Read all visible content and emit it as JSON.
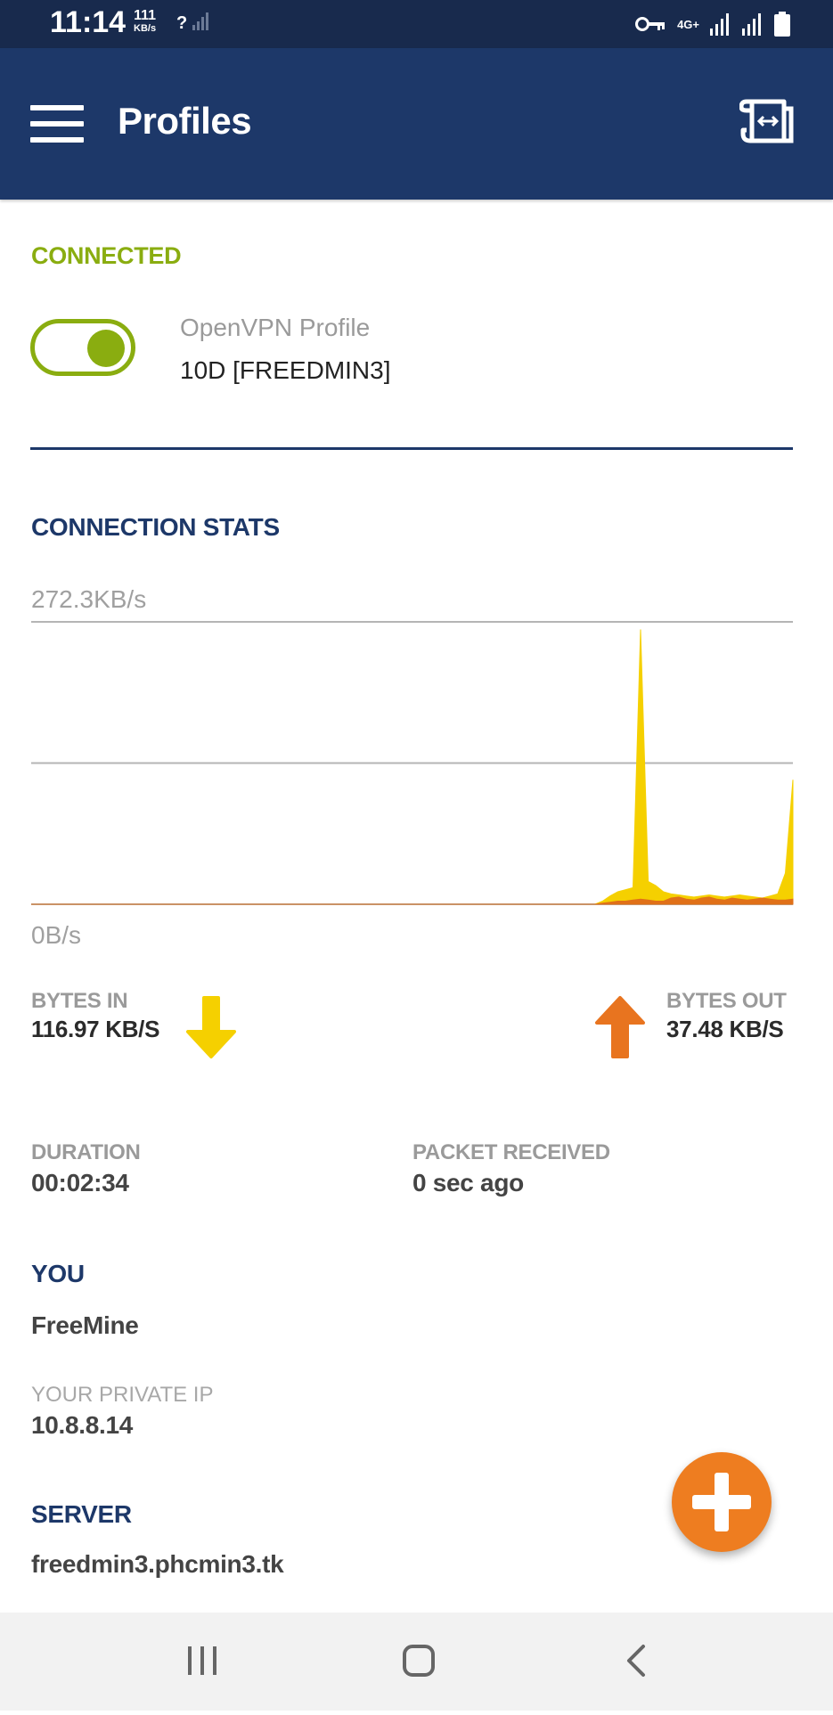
{
  "status_bar": {
    "time": "11:14",
    "speed_value": "111",
    "speed_unit": "KB/s",
    "network_unknown": "?",
    "network_type": "4G+",
    "icons": [
      "vpn-key-icon",
      "signal-icon",
      "signal-icon",
      "battery-icon"
    ]
  },
  "app_bar": {
    "title": "Profiles",
    "icons": [
      "menu-icon",
      "import-profile-icon"
    ]
  },
  "connection": {
    "status": "CONNECTED",
    "connected": true,
    "profile_type": "OpenVPN Profile",
    "profile_name": "10D [FREEDMIN3]"
  },
  "stats": {
    "heading": "CONNECTION STATS",
    "bytes_in_label": "BYTES IN",
    "bytes_in_value": "116.97 KB/S",
    "bytes_out_label": "BYTES OUT",
    "bytes_out_value": "37.48 KB/S",
    "duration_label": "DURATION",
    "duration_value": "00:02:34",
    "packet_label": "PACKET RECEIVED",
    "packet_value": "0 sec ago"
  },
  "chart_data": {
    "type": "area",
    "ylabel_max": "272.3KB/s",
    "ylabel_min": "0B/s",
    "ylim": [
      0,
      272.3
    ],
    "grid": true,
    "series": [
      {
        "color": "#f5d000",
        "values": [
          0,
          0,
          0,
          0,
          0,
          0,
          0,
          0,
          0,
          0,
          0,
          0,
          0,
          0,
          0,
          0,
          0,
          0,
          0,
          0,
          0,
          0,
          0,
          0,
          0,
          0,
          0,
          0,
          0,
          0,
          0,
          0,
          0,
          0,
          0,
          0,
          0,
          0,
          0,
          0,
          0,
          0,
          0,
          0,
          0,
          0,
          0,
          0,
          0,
          0,
          0,
          0,
          0,
          0,
          0,
          0,
          0,
          0,
          0,
          0,
          0,
          0,
          0,
          0,
          0,
          0,
          0,
          0,
          0,
          0,
          0,
          0,
          0,
          0,
          0,
          3,
          8,
          12,
          14,
          16,
          265,
          22,
          18,
          12,
          10,
          9,
          8,
          7,
          8,
          9,
          8,
          7,
          8,
          9,
          8,
          7,
          6,
          8,
          10,
          30,
          120
        ]
      },
      {
        "color": "#e07018",
        "values": [
          0,
          0,
          0,
          0,
          0,
          0,
          0,
          0,
          0,
          0,
          0,
          0,
          0,
          0,
          0,
          0,
          0,
          0,
          0,
          0,
          0,
          0,
          0,
          0,
          0,
          0,
          0,
          0,
          0,
          0,
          0,
          0,
          0,
          0,
          0,
          0,
          0,
          0,
          0,
          0,
          0,
          0,
          0,
          0,
          0,
          0,
          0,
          0,
          0,
          0,
          0,
          0,
          0,
          0,
          0,
          0,
          0,
          0,
          0,
          0,
          0,
          0,
          0,
          0,
          0,
          0,
          0,
          0,
          0,
          0,
          0,
          0,
          0,
          0,
          0,
          1,
          2,
          3,
          3,
          4,
          5,
          4,
          3,
          3,
          6,
          7,
          5,
          4,
          6,
          7,
          5,
          4,
          6,
          5,
          4,
          5,
          6,
          5,
          4,
          4,
          5
        ]
      }
    ],
    "colors": {
      "in": "#f5d000",
      "out": "#e07018",
      "grid": "#b5b5b5"
    }
  },
  "you": {
    "heading": "YOU",
    "name": "FreeMine",
    "ip_label": "YOUR PRIVATE IP",
    "ip_value": "10.8.8.14"
  },
  "server": {
    "heading": "SERVER",
    "host": "freedmin3.phcmin3.tk"
  },
  "theme": {
    "primary": "#1d3869",
    "status_bar": "#182a4d",
    "accent_green": "#8aad10",
    "fab_orange": "#ee7d20"
  },
  "nav_bar": {
    "icons": [
      "recents-icon",
      "home-icon",
      "back-icon"
    ]
  }
}
